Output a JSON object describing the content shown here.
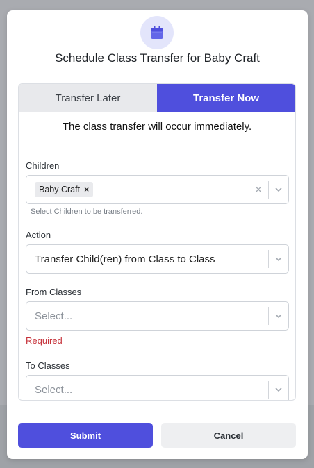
{
  "modal": {
    "title": "Schedule Class Transfer for Baby Craft",
    "icon": "calendar-icon",
    "accent_color": "#4f4fdd"
  },
  "tabs": [
    {
      "label": "Transfer Later",
      "active": false
    },
    {
      "label": "Transfer Now",
      "active": true
    }
  ],
  "notice": "The class transfer will occur immediately.",
  "fields": {
    "children": {
      "label": "Children",
      "chips": [
        "Baby Craft"
      ],
      "helper": "Select Children to be transferred."
    },
    "action": {
      "label": "Action",
      "value": "Transfer Child(ren) from Class to Class"
    },
    "from_classes": {
      "label": "From Classes",
      "placeholder": "Select...",
      "error": "Required"
    },
    "to_classes": {
      "label": "To Classes",
      "placeholder": "Select..."
    }
  },
  "buttons": {
    "submit": "Submit",
    "cancel": "Cancel"
  }
}
